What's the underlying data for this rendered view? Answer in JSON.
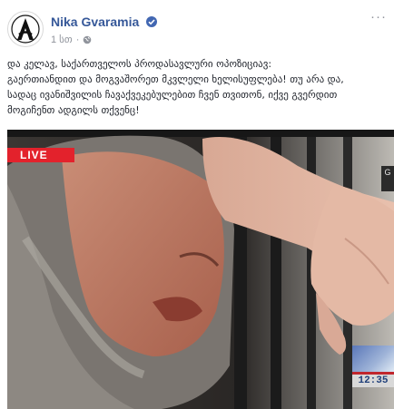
{
  "post": {
    "author": "Nika Gvaramia",
    "timestamp": "1 სთ",
    "privacy_icon": "globe-icon",
    "verified_icon": "verified-badge-icon",
    "options_label": "···",
    "text_lines": [
      "და კელავ, საქართველოს პროდასავლური ოპოზიციავ:",
      "გაერთიანდით და მოგვაშორეთ მკვლელი ხელისუფლება! თუ არა და,",
      "სადაც ივანიშვილის ჩავაქვეკებულებით ჩვენ თვითონ, იქვე გვერდით",
      "მოგიჩენთ ადგილს თქვენც!"
    ]
  },
  "video": {
    "live_label": "LIVE",
    "clock_text": "12:35",
    "side_badge_text": "G"
  },
  "colors": {
    "author_link": "#365899",
    "live_red": "#e3222c",
    "meta_gray": "#90949c"
  }
}
